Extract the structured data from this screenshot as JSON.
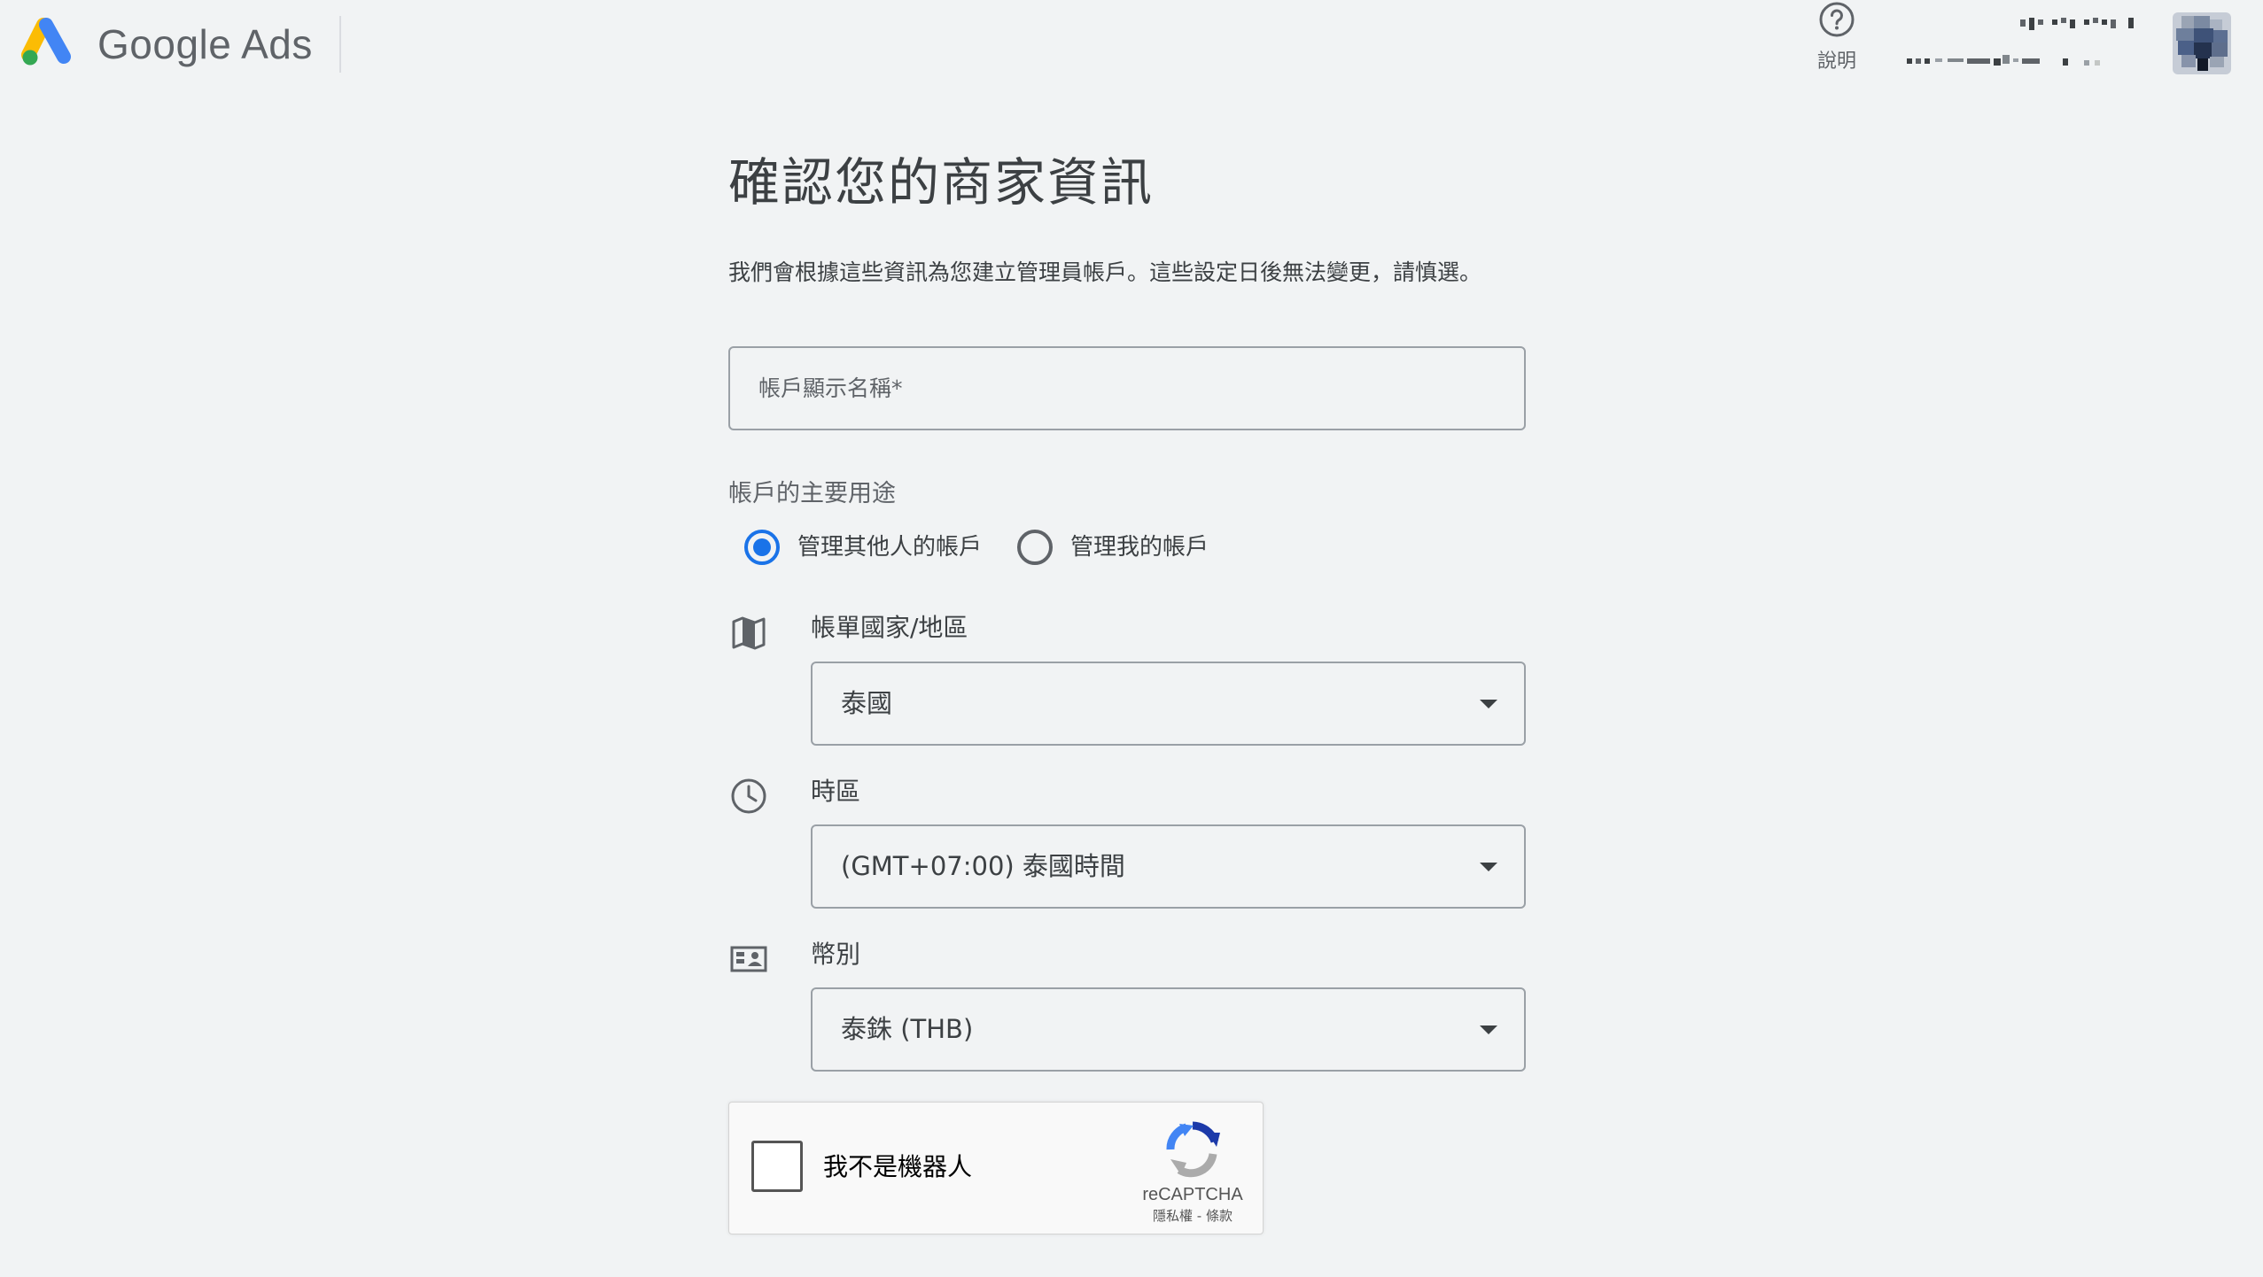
{
  "header": {
    "product_name": "Google Ads",
    "help_label": "說明"
  },
  "form": {
    "title": "確認您的商家資訊",
    "subtitle": "我們會根據這些資訊為您建立管理員帳戶。這些設定日後無法變更，請慎選。",
    "account_name_placeholder": "帳戶顯示名稱*",
    "account_name_value": "",
    "purpose_label": "帳戶的主要用途",
    "purpose_options": [
      {
        "label": "管理其他人的帳戶",
        "selected": true
      },
      {
        "label": "管理我的帳戶",
        "selected": false
      }
    ],
    "billing_country": {
      "label": "帳單國家/地區",
      "value": "泰國",
      "icon": "map-icon"
    },
    "time_zone": {
      "label": "時區",
      "value": "(GMT+07:00) 泰國時間",
      "icon": "clock-icon"
    },
    "currency": {
      "label": "幣別",
      "value": "泰銖 (THB)",
      "icon": "currency-icon"
    }
  },
  "recaptcha": {
    "label": "我不是機器人",
    "brand": "reCAPTCHA",
    "privacy": "隱私權",
    "separator": "-",
    "terms": "條款",
    "checked": false
  },
  "colors": {
    "background": "#f1f3f4",
    "accent": "#1a73e8",
    "text": "#3c4043",
    "secondary_text": "#5f6368"
  }
}
